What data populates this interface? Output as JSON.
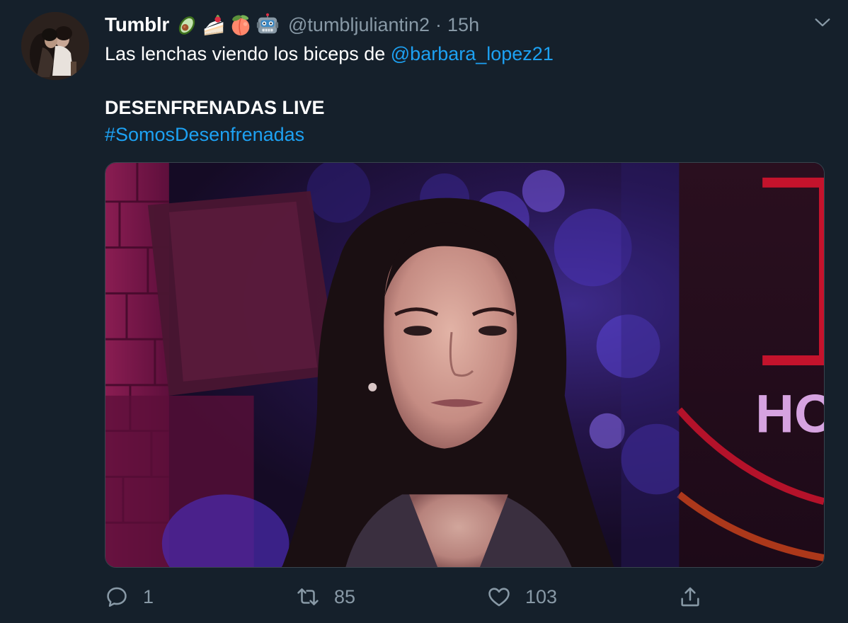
{
  "tweet": {
    "display_name": "Tumblr",
    "name_emojis": [
      "avocado-emoji",
      "shortcake-emoji",
      "peach-emoji",
      "robot-emoji"
    ],
    "handle": "@tumbljuliantin2",
    "separator": "·",
    "time": "15h",
    "text": {
      "line1_prefix": "Las lenchas viendo los biceps de ",
      "mention": "@barbara_lopez21",
      "line2": "DESENFRENADAS LIVE",
      "hashtag": "#SomosDesenfrenadas"
    },
    "media_overlay_text": "HO",
    "actions": {
      "reply_count": "1",
      "retweet_count": "85",
      "like_count": "103"
    }
  },
  "colors": {
    "background": "#15202b",
    "text_primary": "#ffffff",
    "text_secondary": "#8899a6",
    "link": "#1da1f2",
    "border": "#38444d"
  },
  "icons": {
    "more": "chevron-down-icon",
    "reply": "reply-icon",
    "retweet": "retweet-icon",
    "like": "heart-icon",
    "share": "share-icon"
  }
}
